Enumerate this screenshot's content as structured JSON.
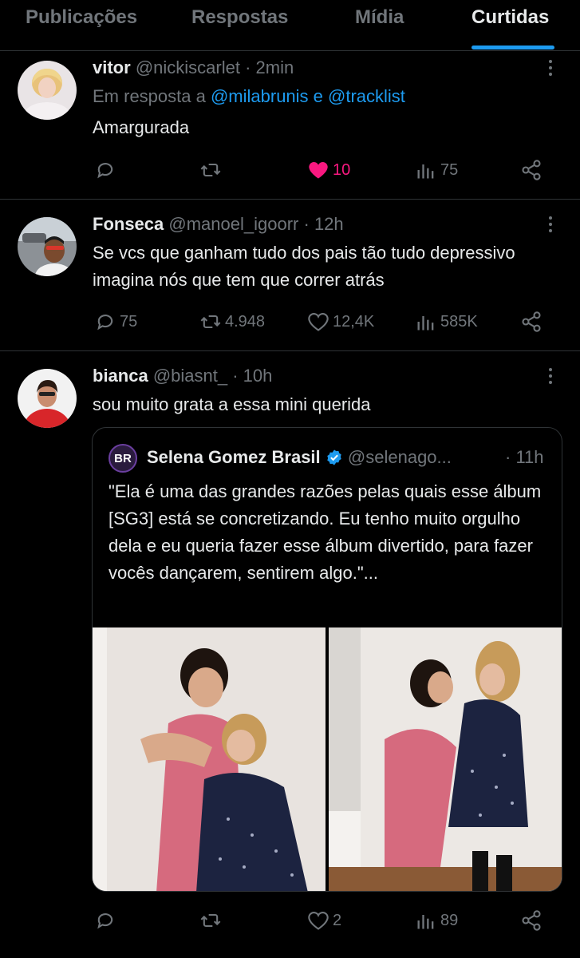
{
  "tabs": [
    {
      "label": "Publicações"
    },
    {
      "label": "Respostas"
    },
    {
      "label": "Mídia"
    },
    {
      "label": "Curtidas"
    }
  ],
  "colors": {
    "accent": "#1d9bf0",
    "like": "#f91880",
    "muted": "#71767b",
    "text": "#e7e9ea"
  },
  "posts": [
    {
      "name": "vitor",
      "handle": "@nickiscarlet",
      "time": "· 2min",
      "reply_prefix": "Em resposta a",
      "reply_to": "@milabrunis e @tracklist",
      "text": "Amargurada",
      "replies": "",
      "reposts": "",
      "likes": "10",
      "liked": true,
      "views": "75"
    },
    {
      "name": "Fonseca",
      "handle": "@manoel_igoorr",
      "time": "· 12h",
      "text": "Se vcs que ganham tudo dos pais tão tudo depressivo imagina nós que tem que correr atrás",
      "replies": "75",
      "reposts": "4.948",
      "likes": "12,4K",
      "views": "585K"
    },
    {
      "name": "bianca",
      "handle": "@biasnt_",
      "time": "· 10h",
      "text": "sou muito grata a essa mini querida",
      "replies": "",
      "reposts": "",
      "likes": "2",
      "views": "89",
      "quote": {
        "avatar_text": "BR",
        "name": "Selena Gomez Brasil",
        "handle": "@selenago...",
        "time": "· 11h",
        "text": "\"Ela é uma das grandes razões pelas quais esse álbum [SG3] está se concretizando. Eu tenho muito orgulho dela e eu queria fazer esse álbum divertido, para fazer vocês dançarem, sentirem algo.\"..."
      }
    }
  ]
}
